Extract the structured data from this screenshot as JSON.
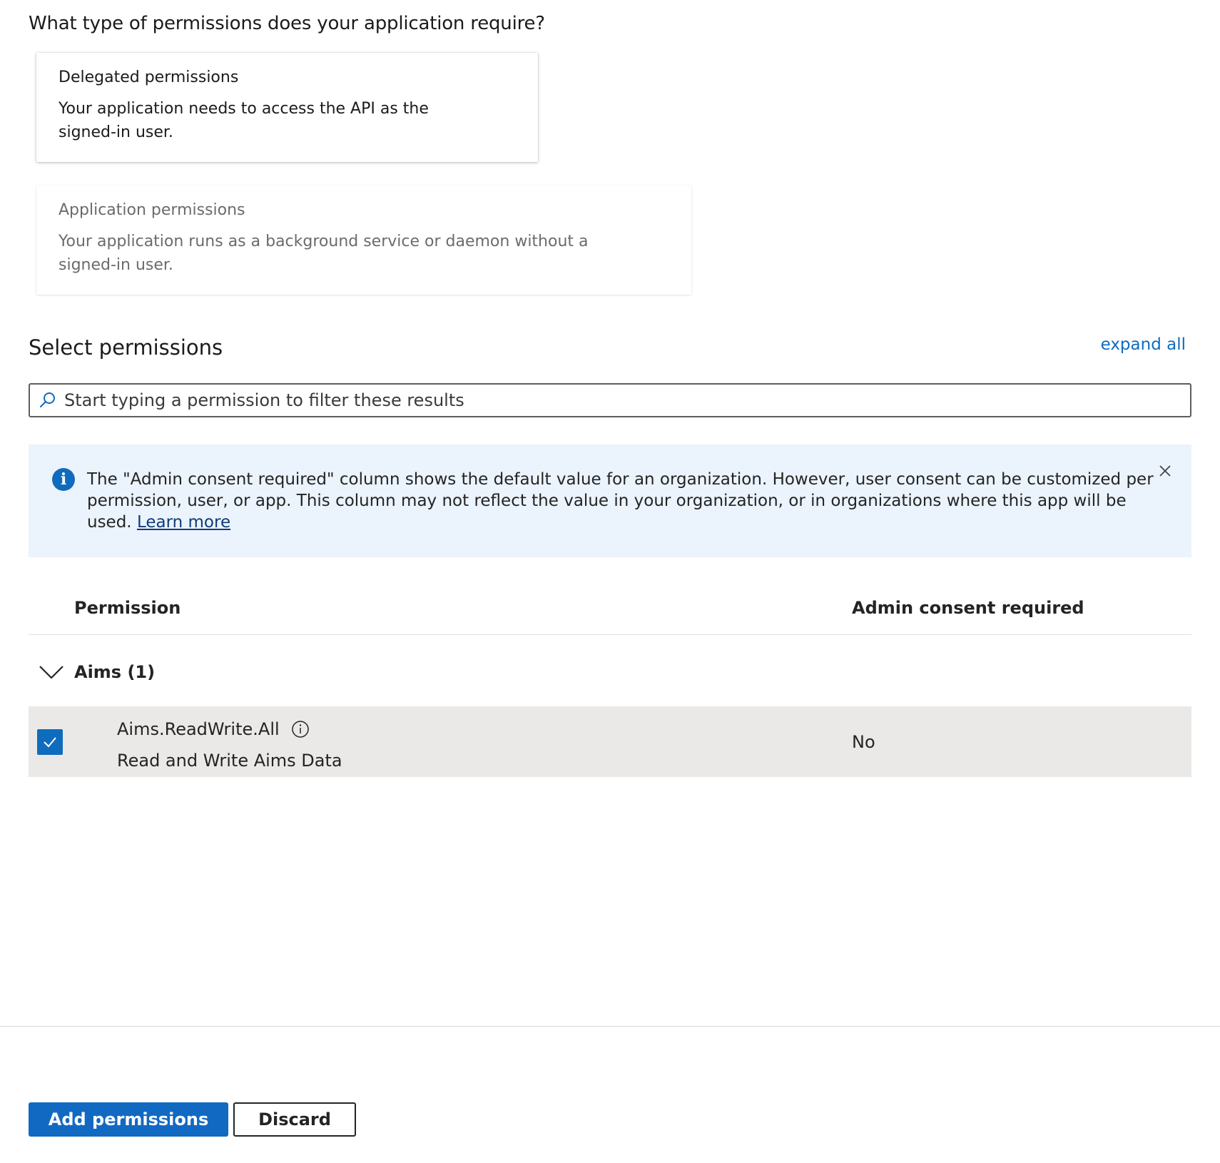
{
  "question": "What type of permissions does your application require?",
  "permission_types": [
    {
      "title": "Delegated permissions",
      "description": "Your application needs to access the API as the signed-in user.",
      "selected": true
    },
    {
      "title": "Application permissions",
      "description": "Your application runs as a background service or daemon without a signed-in user.",
      "selected": false
    }
  ],
  "select_section": {
    "title": "Select permissions",
    "expand_all": "expand all",
    "search_placeholder": "Start typing a permission to filter these results",
    "search_icon": "search-icon"
  },
  "info_bar": {
    "icon": "info-icon",
    "text": "The \"Admin consent required\" column shows the default value for an organization. However, user consent can be customized per permission, user, or app. This column may not reflect the value in your organization, or in organizations where this app will be used. ",
    "link": "Learn more",
    "close_icon": "close-icon"
  },
  "table": {
    "columns": [
      "Permission",
      "Admin consent required"
    ],
    "groups": [
      {
        "label": "Aims (1)",
        "expanded": true,
        "items": [
          {
            "name": "Aims.ReadWrite.All",
            "description": "Read and Write Aims Data",
            "admin_consent": "No",
            "checked": true
          }
        ]
      }
    ]
  },
  "buttons": {
    "primary": "Add permissions",
    "secondary": "Discard"
  },
  "colors": {
    "accent": "#0f6cbd",
    "primary_button": "#1269c2",
    "info_background": "#ebf3fc",
    "selected_row": "#ebe9e7"
  }
}
